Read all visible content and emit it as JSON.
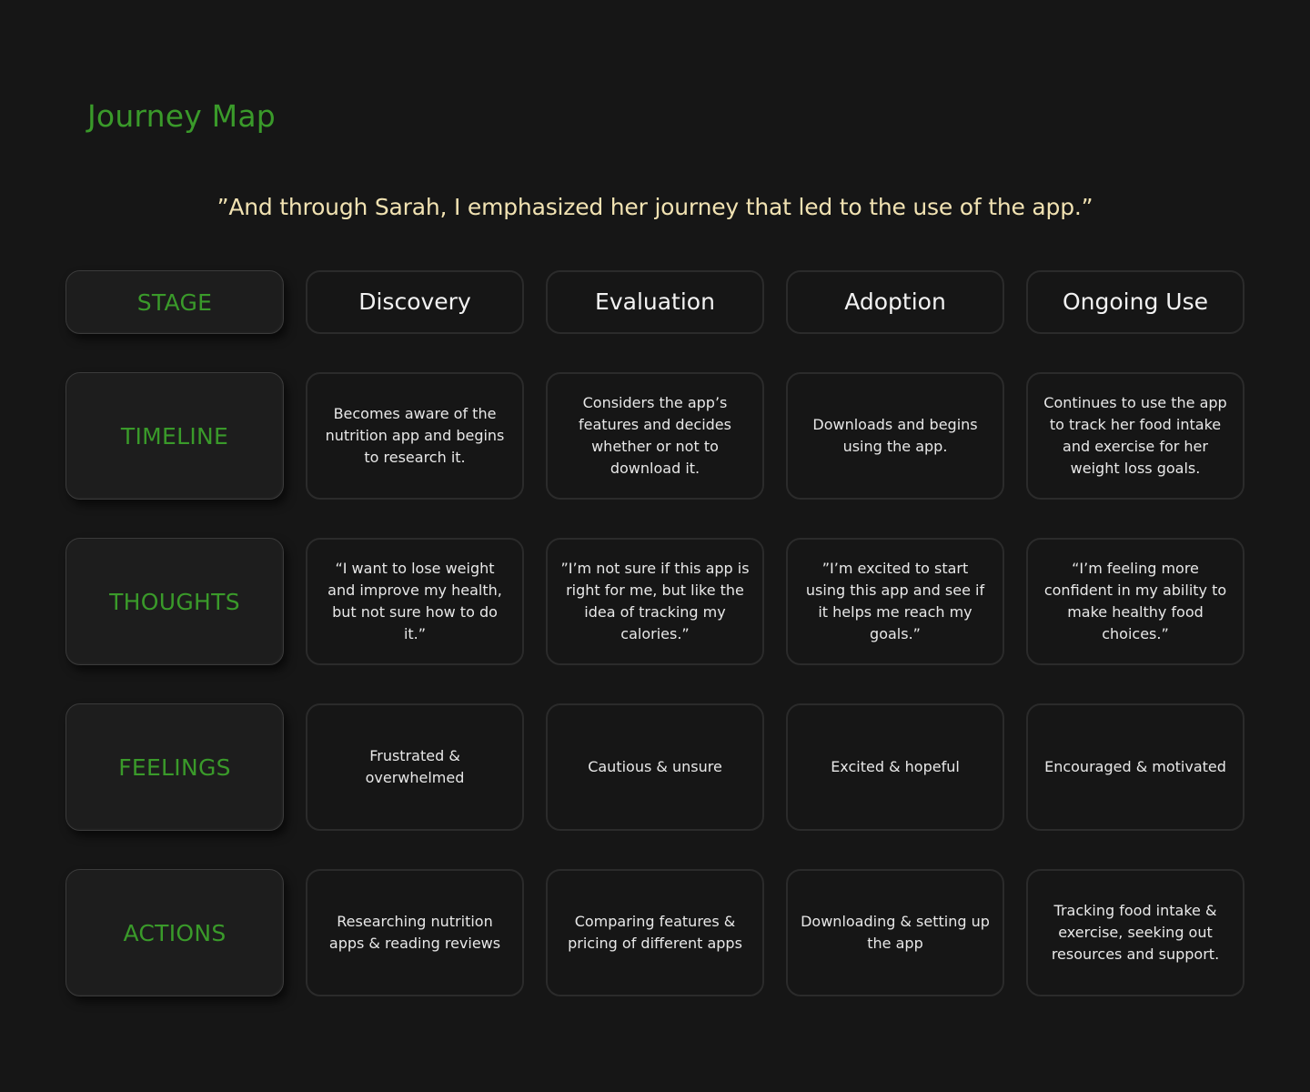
{
  "title": "Journey Map",
  "quote": "”And through Sarah, I emphasized her journey that led to the use of the app.”",
  "colors": {
    "background": "#161616",
    "accent_green": "#3a9a2a",
    "quote_cream": "#f1e2b2"
  },
  "stage_row": {
    "label": "STAGE",
    "stages": [
      "Discovery",
      "Evaluation",
      "Adoption",
      "Ongoing Use"
    ]
  },
  "rows": [
    {
      "label": "TIMELINE",
      "cells": [
        "Becomes aware of the nutrition app and begins to research it.",
        "Considers the app’s features and decides whether or not to download it.",
        "Downloads and begins using the app.",
        "Continues to use the app to track her food intake and exercise for her weight loss goals."
      ]
    },
    {
      "label": "THOUGHTS",
      "cells": [
        "“I want to lose weight and improve my health, but not sure how to do it.”",
        "”I’m not sure if this app is right for me, but like the idea of tracking my calories.”",
        "”I’m excited to start using this app and see if it helps me reach my goals.”",
        "“I’m feeling more confident in my ability to make healthy food choices.”"
      ]
    },
    {
      "label": "FEELINGS",
      "cells": [
        "Frustrated & overwhelmed",
        "Cautious & unsure",
        "Excited & hopeful",
        "Encouraged & motivated"
      ]
    },
    {
      "label": "ACTIONS",
      "cells": [
        "Researching nutrition apps & reading reviews",
        "Comparing features & pricing of different apps",
        "Downloading & setting up the app",
        "Tracking food intake & exercise, seeking out resources and support."
      ]
    }
  ]
}
